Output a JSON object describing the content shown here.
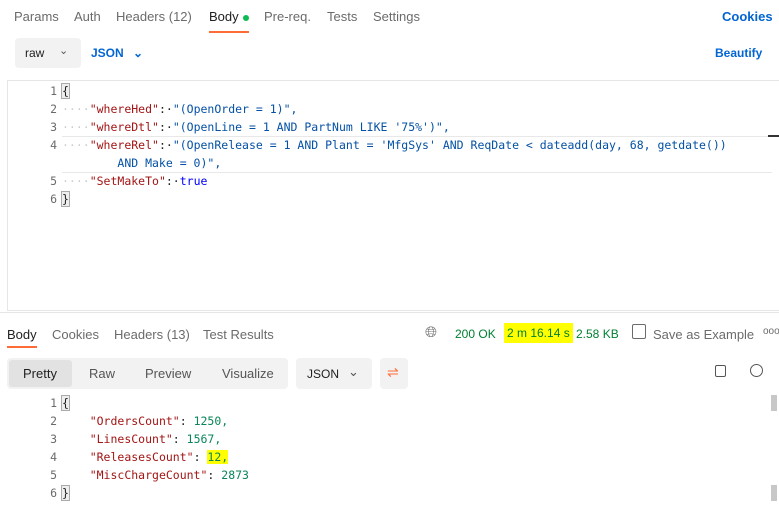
{
  "request_tabs": [
    {
      "label": "Params"
    },
    {
      "label": "Auth"
    },
    {
      "label": "Headers (12)"
    },
    {
      "label": "Body",
      "active": true
    },
    {
      "label": "Pre-req."
    },
    {
      "label": "Tests"
    },
    {
      "label": "Settings"
    }
  ],
  "cookies": "Cookies",
  "body_mode": "raw",
  "body_format": "JSON",
  "beautify": "Beautify",
  "request_body": {
    "line_numbers": [
      "1",
      "2",
      "3",
      "4",
      "",
      "5",
      "6"
    ],
    "lines": [
      {
        "p": "{"
      },
      {
        "k": "\"whereHed\"",
        "s": "\"(OpenOrder = 1)\","
      },
      {
        "k": "\"whereDtl\"",
        "s": "\"(OpenLine = 1 AND PartNum LIKE '75%')\","
      },
      {
        "k": "\"whereRel\"",
        "s": "\"(OpenRelease = 1 AND Plant = 'MfgSys' AND ReqDate < dateadd(day, 68, getdate())"
      },
      {
        "s": "AND Make = 0)\","
      },
      {
        "k": "\"SetMakeTo\"",
        "b": "true"
      },
      {
        "p": "}"
      }
    ]
  },
  "response_tabs": [
    {
      "label": "Body",
      "active": true
    },
    {
      "label": "Cookies"
    },
    {
      "label": "Headers (13)"
    },
    {
      "label": "Test Results"
    }
  ],
  "status": "200 OK",
  "time": "2 m 16.14 s",
  "size": "2.58 KB",
  "save_example": "Save as Example",
  "more": "ooo",
  "view_modes": [
    {
      "label": "Pretty",
      "active": true
    },
    {
      "label": "Raw"
    },
    {
      "label": "Preview"
    },
    {
      "label": "Visualize"
    }
  ],
  "response_format": "JSON",
  "response_body": {
    "line_numbers": [
      "1",
      "2",
      "3",
      "4",
      "5",
      "6"
    ],
    "lines": [
      {
        "p": "{"
      },
      {
        "k": "\"OrdersCount\"",
        "n": "1250,"
      },
      {
        "k": "\"LinesCount\"",
        "n": "1567,"
      },
      {
        "k": "\"ReleasesCount\"",
        "n": "12,"
      },
      {
        "k": "\"MiscChargeCount\"",
        "n": "2873"
      },
      {
        "p": "}"
      }
    ]
  },
  "colors": {
    "accent": "#ff6c37",
    "link": "#0265d2",
    "highlight": "#ffff00",
    "status": "#007f31"
  }
}
